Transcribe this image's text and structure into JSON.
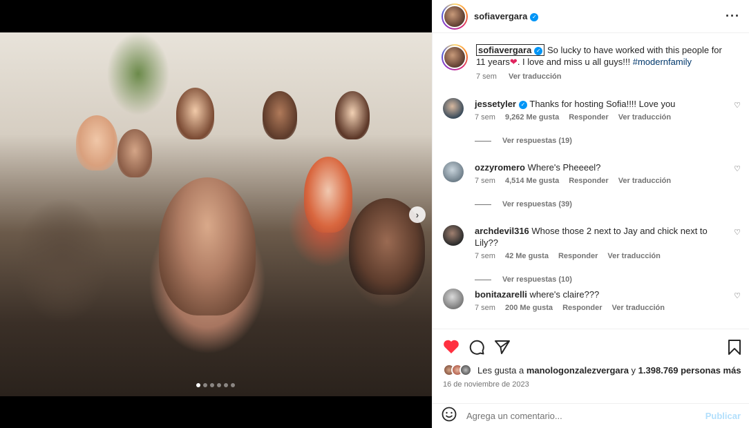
{
  "post": {
    "username": "sofiavergara",
    "caption": {
      "username": "sofiavergara",
      "text_before": "So lucky to have worked with this people for 11 years",
      "text_after": ". I love and miss u all guys!!! ",
      "hashtag": "#modernfamily",
      "time": "7 sem",
      "translate": "Ver traducción"
    },
    "carousel": {
      "slide_count": 6,
      "active_index": 0
    }
  },
  "comments": [
    {
      "username": "jessetyler",
      "verified": true,
      "text": "Thanks for hosting Sofia!!!! Love you",
      "time": "7 sem",
      "likes": "9,262 Me gusta",
      "reply": "Responder",
      "translate": "Ver traducción",
      "replies": "Ver respuestas (19)",
      "avatar_color": "#3a4b5a"
    },
    {
      "username": "ozzyromero",
      "verified": false,
      "text": "Where's Pheeeel?",
      "time": "7 sem",
      "likes": "4,514 Me gusta",
      "reply": "Responder",
      "translate": "Ver traducción",
      "replies": "Ver respuestas (39)",
      "avatar_color": "#8a9aa8"
    },
    {
      "username": "archdevil316",
      "verified": false,
      "text": "Whose those 2 next to Jay and chick next to Lily??",
      "time": "7 sem",
      "likes": "42 Me gusta",
      "reply": "Responder",
      "translate": "Ver traducción",
      "replies": "Ver respuestas (10)",
      "avatar_color": "#2b2b2b"
    },
    {
      "username": "bonitazarelli",
      "verified": false,
      "text": "where's claire???",
      "time": "7 sem",
      "likes": "200 Me gusta",
      "reply": "Responder",
      "translate": "Ver traducción",
      "replies": "",
      "avatar_color": "#9a9a9a"
    }
  ],
  "likes": {
    "prefix": "Les gusta a ",
    "user": "manologonzalezvergara",
    "middle": " y ",
    "count": "1.398.769 personas más"
  },
  "date": "16 de noviembre de 2023",
  "add_comment": {
    "placeholder": "Agrega un comentario...",
    "post_label": "Publicar"
  },
  "icons": {
    "like": "heart-filled-icon",
    "comment": "comment-icon",
    "share": "share-icon",
    "save": "bookmark-icon",
    "more": "more-options-icon",
    "emoji": "emoji-icon",
    "next": "chevron-right-icon"
  },
  "colors": {
    "like_red": "#ff3040",
    "link_blue": "#00376b",
    "verified_blue": "#0095f6",
    "post_disabled": "#b2dffc"
  }
}
